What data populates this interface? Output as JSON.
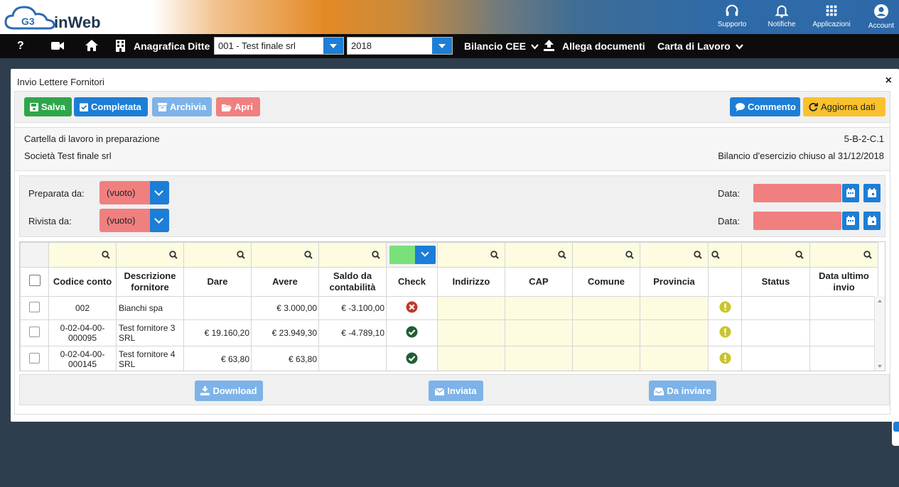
{
  "brand": {
    "logo_text": "inWeb",
    "logo_badge": "G3"
  },
  "top_actions": [
    {
      "label": "Supporto",
      "icon": "headset-icon"
    },
    {
      "label": "Notifiche",
      "icon": "bell-icon"
    },
    {
      "label": "Applicazioni",
      "icon": "grid-icon"
    },
    {
      "label": "Account",
      "icon": "user-circle-icon"
    }
  ],
  "navbar": {
    "help": "?",
    "anagrafica": "Anagrafica Ditte",
    "company_select": "001 - Test finale srl",
    "year_select": "2018",
    "bilancio": "Bilancio CEE",
    "allega": "Allega documenti",
    "carta": "Carta di Lavoro"
  },
  "modal": {
    "title": "Invio Lettere Fornitori",
    "close": "×"
  },
  "toolbar": {
    "salva": "Salva",
    "completata": "Completata",
    "archivia": "Archivia",
    "apri": "Apri",
    "commento": "Commento",
    "aggiorna": "Aggiorna dati"
  },
  "colors": {
    "green": "#2ea64a",
    "blue": "#1c7ed6",
    "light_blue": "#7db3e8",
    "pink": "#f08080",
    "yellow": "#f9c12e",
    "filter_yellow": "#fdfbe0"
  },
  "info": {
    "status": "Cartella di lavoro in preparazione",
    "code": "5-B-2-C.1",
    "company": "Società Test finale srl",
    "bilancio": "Bilancio d'esercizio chiuso al 31/12/2018"
  },
  "filters": {
    "preparata_label": "Preparata da:",
    "preparata_value": "(vuoto)",
    "rivista_label": "Rivista da:",
    "rivista_value": "(vuoto)",
    "data_label_1": "Data:",
    "data_label_2": "Data:"
  },
  "table": {
    "columns": [
      "Codice conto",
      "Descrizione fornitore",
      "Dare",
      "Avere",
      "Saldo da contabilità",
      "Check",
      "Indirizzo",
      "CAP",
      "Comune",
      "Provincia",
      "",
      "Status",
      "Data ultimo invio"
    ],
    "rows": [
      {
        "codice": "002",
        "descrizione": "Bianchi spa",
        "dare": "",
        "avere": "€ 3.000,00",
        "saldo": "€ -3.100,00",
        "check": "error",
        "status_icon": "warning"
      },
      {
        "codice": "0-02-04-00-000095",
        "descrizione": "Test fornitore 3 SRL",
        "dare": "€ 19.160,20",
        "avere": "€ 23.949,30",
        "saldo": "€ -4.789,10",
        "check": "ok",
        "status_icon": "warning"
      },
      {
        "codice": "0-02-04-00-000145",
        "descrizione": "Test fornitore 4 SRL",
        "dare": "€ 63,80",
        "avere": "€ 63,80",
        "saldo": "",
        "check": "ok",
        "status_icon": "warning"
      }
    ]
  },
  "bottom": {
    "download": "Download",
    "inviata": "Inviata",
    "da_inviare": "Da inviare"
  }
}
